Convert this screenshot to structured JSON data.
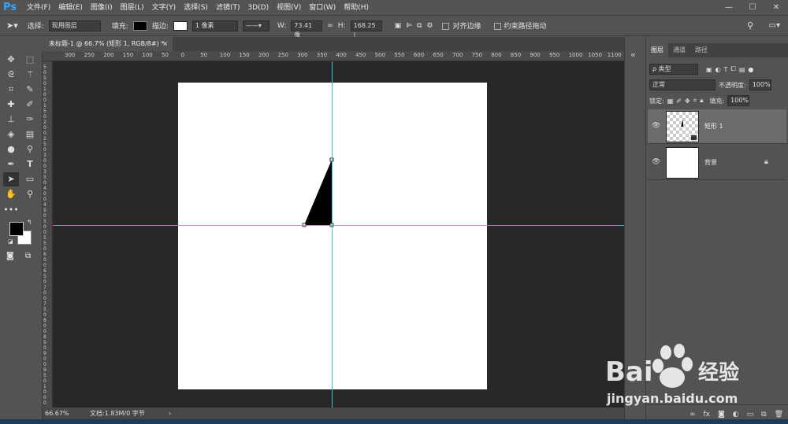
{
  "app": {
    "logo": "Ps"
  },
  "menu": [
    "文件(F)",
    "编辑(E)",
    "图像(I)",
    "图层(L)",
    "文字(Y)",
    "选择(S)",
    "滤镜(T)",
    "3D(D)",
    "视图(V)",
    "窗口(W)",
    "帮助(H)"
  ],
  "window_controls": {
    "minimize": "—",
    "maximize": "☐",
    "close": "✕"
  },
  "options": {
    "select_label": "选择:",
    "select_value": "现用图层",
    "fill_label": "填充:",
    "stroke_label": "描边:",
    "stroke_width": "1 像素",
    "w_label": "W:",
    "w_value": "73.41 像",
    "h_label": "H:",
    "h_value": "168.25 |",
    "align_edges": "对齐边缘",
    "constrain_path": "约束路径拖动",
    "fill_color": "#000000",
    "stroke_color": "#ffffff"
  },
  "document": {
    "tab_title": "未标题-1 @ 66.7% (矩形 1, RGB/8#) *",
    "tab_close": "×",
    "zoom": "66.67%",
    "doc_info": "文档:1.83M/0 字节",
    "guide_color": "#37c5cc",
    "shape_color": "#000000"
  },
  "ruler_h": [
    "300",
    "250",
    "200",
    "150",
    "100",
    "50",
    "0",
    "50",
    "100",
    "150",
    "200",
    "250",
    "300",
    "350",
    "400",
    "450",
    "500",
    "550",
    "600",
    "650",
    "700",
    "750",
    "800",
    "850",
    "900",
    "950",
    "1000",
    "1050",
    "1100"
  ],
  "ruler_v": [
    "5",
    "0",
    "5",
    "0",
    "1",
    "0",
    "0",
    "1",
    "5",
    "0",
    "2",
    "0",
    "0",
    "2",
    "5",
    "0",
    "3",
    "0",
    "0",
    "3",
    "5",
    "0",
    "4",
    "0",
    "0",
    "4",
    "5",
    "0",
    "5",
    "0",
    "0",
    "5",
    "5",
    "0",
    "6",
    "0",
    "0",
    "6",
    "5",
    "0",
    "7",
    "0",
    "0",
    "7",
    "5",
    "0",
    "8",
    "0",
    "0",
    "8",
    "5",
    "0",
    "9",
    "0",
    "0",
    "9",
    "5",
    "0",
    "1",
    "0",
    "0",
    "0"
  ],
  "panel": {
    "tabs": [
      "图层",
      "通道",
      "路径"
    ],
    "kind_filter": "ρ 类型",
    "blend_mode": "正常",
    "opacity_label": "不透明度:",
    "opacity_value": "100%",
    "lock_label": "锁定:",
    "fill_label": "填充:",
    "fill_value": "100%",
    "layers": [
      {
        "name": "矩形 1",
        "selected": true
      },
      {
        "name": "背景",
        "selected": false,
        "locked": true
      }
    ]
  },
  "watermark": {
    "brand": "Bai",
    "brand2": "经验",
    "url": "jingyan.baidu.com"
  }
}
